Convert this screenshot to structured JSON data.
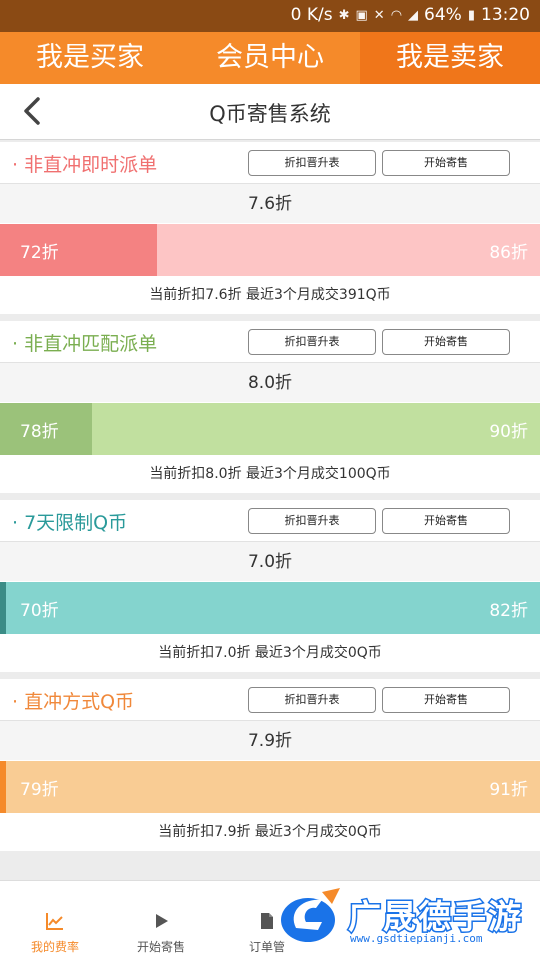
{
  "status": {
    "speed": "0 K/s",
    "battery": "64%",
    "time": "13:20"
  },
  "topnav": {
    "buyer": "我是买家",
    "member": "会员中心",
    "seller": "我是卖家"
  },
  "titlebar": {
    "title": "Q币寄售系统"
  },
  "buttons": {
    "rank": "折扣晋升表",
    "start": "开始寄售"
  },
  "cards": [
    {
      "name": "· 非直冲即时派单",
      "current": "7.6折",
      "min": "72折",
      "max": "86折",
      "progress": 0.29,
      "info": "当前折扣7.6折  最近3个月成交391Q币",
      "colors": {
        "name": "#f07070",
        "fill": "#f48282",
        "track": "#fdc5c5",
        "marker": "#f48282"
      }
    },
    {
      "name": "· 非直冲匹配派单",
      "current": "8.0折",
      "min": "78折",
      "max": "90折",
      "progress": 0.17,
      "info": "当前折扣8.0折  最近3个月成交100Q币",
      "colors": {
        "name": "#7aae50",
        "fill": "#9bc27a",
        "track": "#c1e09f",
        "marker": "#9bc27a"
      }
    },
    {
      "name": "· 7天限制Q币",
      "current": "7.0折",
      "min": "70折",
      "max": "82折",
      "progress": 0.0,
      "info": "当前折扣7.0折  最近3个月成交0Q币",
      "colors": {
        "name": "#2a9a9a",
        "fill": "#5aa7a0",
        "track": "#84d4ce",
        "marker": "#3a8c86"
      }
    },
    {
      "name": "· 直冲方式Q币",
      "current": "7.9折",
      "min": "79折",
      "max": "91折",
      "progress": 0.0,
      "info": "当前折扣7.9折  最近3个月成交0Q币",
      "colors": {
        "name": "#f0883a",
        "fill": "#f6a860",
        "track": "#f9cc94",
        "marker": "#f58a2a"
      }
    }
  ],
  "bottomnav": [
    {
      "label": "我的费率",
      "icon": "chart-icon",
      "color": "#f58a2a"
    },
    {
      "label": "开始寄售",
      "icon": "play-icon",
      "color": "#555555"
    },
    {
      "label": "订单管",
      "icon": "document-icon",
      "color": "#555555"
    }
  ],
  "watermark": {
    "text": "广晟德手游",
    "url": "www.gsdtiepianji.com"
  }
}
